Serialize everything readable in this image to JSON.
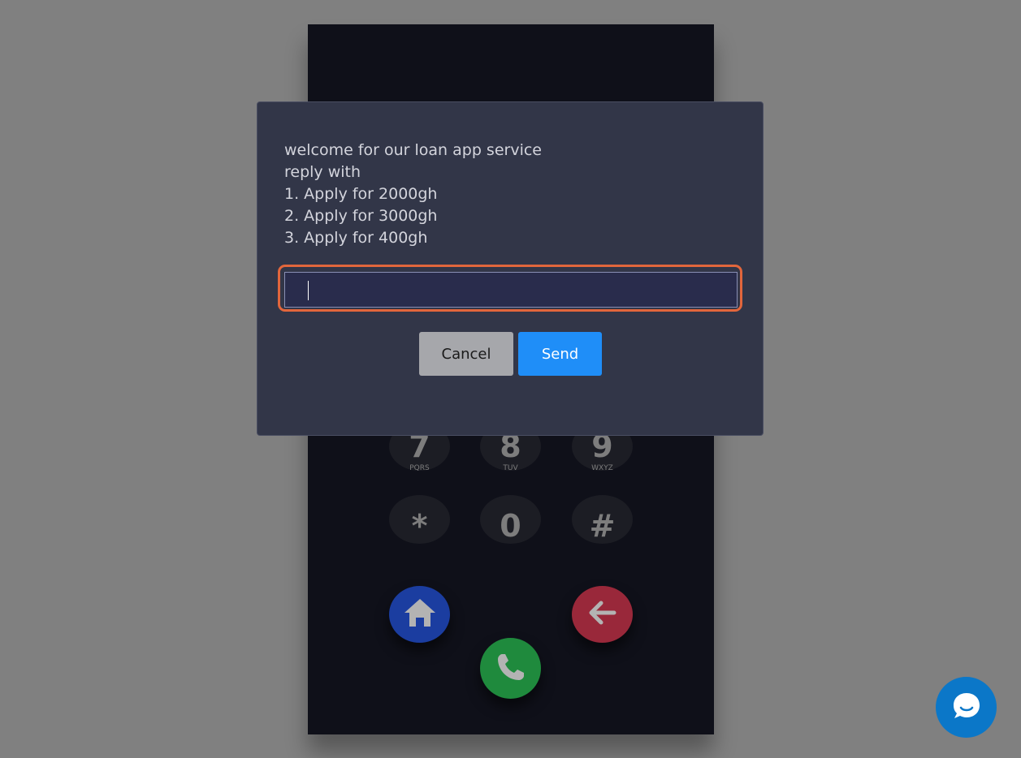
{
  "dialog": {
    "message_lines": [
      "welcome for our loan app service",
      "reply with",
      "1. Apply for 2000gh",
      "2. Apply for 3000gh",
      "3. Apply for 400gh"
    ],
    "input_value": "",
    "cancel_label": "Cancel",
    "send_label": "Send"
  },
  "keypad": {
    "keys": [
      {
        "digit": "7",
        "letters": "PQRS"
      },
      {
        "digit": "8",
        "letters": "TUV"
      },
      {
        "digit": "9",
        "letters": "WXYZ"
      },
      {
        "digit": "*",
        "letters": ""
      },
      {
        "digit": "0",
        "letters": ""
      },
      {
        "digit": "#",
        "letters": ""
      }
    ]
  },
  "actions": {
    "home_icon": "home-icon",
    "back_icon": "arrow-left-icon",
    "call_icon": "phone-icon"
  },
  "chat_widget": {
    "icon": "chat-bubble-icon"
  },
  "colors": {
    "overlay": "#808080",
    "dialog_bg": "#323648",
    "input_focus_ring": "#e2663c",
    "send_button": "#1f8ef8",
    "cancel_button": "#a6a7ab",
    "home_button": "#1b3da0",
    "back_button": "#99283a",
    "call_button": "#1f8a3d",
    "chat_widget": "#0b77c8"
  }
}
